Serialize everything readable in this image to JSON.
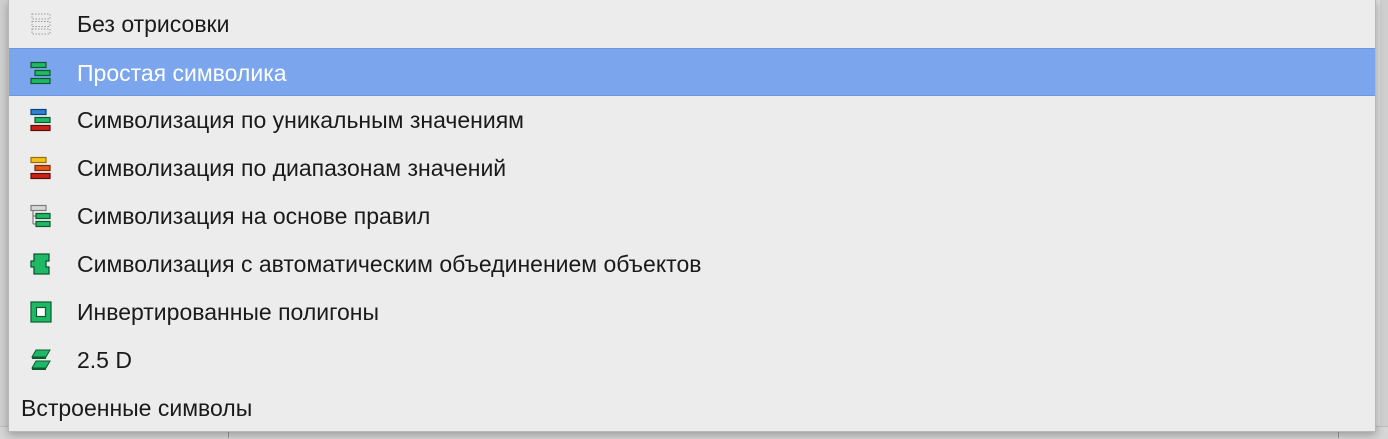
{
  "menu": {
    "items": [
      {
        "label": "Без отрисовки",
        "icon": "no-render-icon",
        "selected": false
      },
      {
        "label": "Простая символика",
        "icon": "single-symbol-icon",
        "selected": true
      },
      {
        "label": "Символизация по уникальным значениям",
        "icon": "categorized-icon",
        "selected": false
      },
      {
        "label": "Символизация по диапазонам значений",
        "icon": "graduated-icon",
        "selected": false
      },
      {
        "label": "Символизация на основе правил",
        "icon": "rule-based-icon",
        "selected": false
      },
      {
        "label": "Символизация с автоматическим объединением объектов",
        "icon": "merged-features-icon",
        "selected": false
      },
      {
        "label": "Инвертированные полигоны",
        "icon": "inverted-polygons-icon",
        "selected": false
      },
      {
        "label": "2.5 D",
        "icon": "two-point-five-d-icon",
        "selected": false
      }
    ],
    "section": {
      "label": "Встроенные символы"
    }
  },
  "colors": {
    "selection": "#7ba5ec",
    "menu_background": "#ececec",
    "green": "#1fb866",
    "blue": "#2a83d6",
    "red": "#c8231b",
    "yellow": "#f4c21a",
    "orange": "#e2591b"
  }
}
